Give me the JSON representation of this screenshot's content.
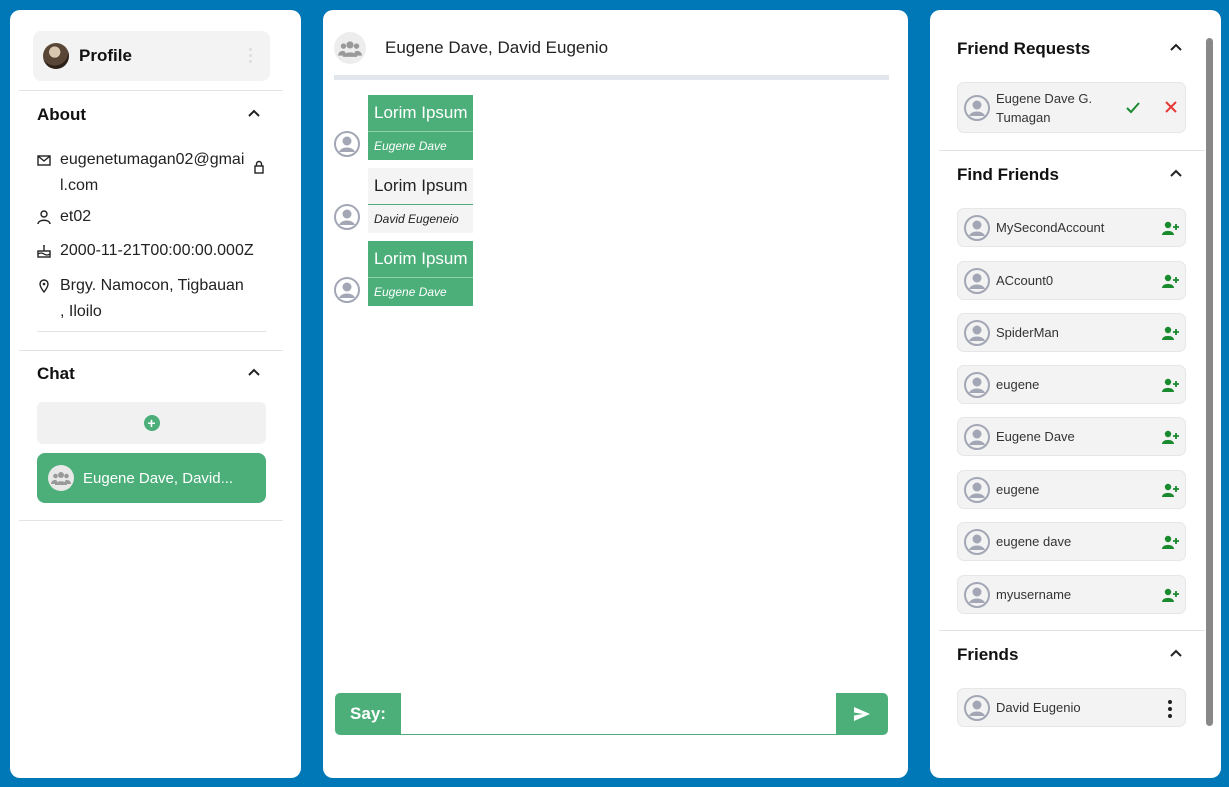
{
  "profile": {
    "name": "Profile"
  },
  "about": {
    "title": "About",
    "email": "eugenetumagan02@gmail.com",
    "username": "et02",
    "birthday": "2000-11-21T00:00:00.000Z",
    "address": "Brgy. Namocon, Tigbauan , Iloilo"
  },
  "chat_section": {
    "title": "Chat",
    "new_chat_symbol": "+",
    "items": [
      {
        "label": "Eugene Dave, David..."
      }
    ]
  },
  "conversation": {
    "title": "Eugene Dave, David Eugenio",
    "messages": [
      {
        "text": "Lorim Ipsum",
        "sender": "Eugene Dave"
      },
      {
        "text": "Lorim Ipsum",
        "sender": "David Eugeneio"
      },
      {
        "text": "Lorim Ipsum",
        "sender": "Eugene Dave"
      }
    ],
    "input": {
      "label": "Say:",
      "value": "",
      "placeholder": ""
    }
  },
  "friend_requests": {
    "title": "Friend Requests",
    "items": [
      {
        "name": "Eugene Dave G. Tumagan"
      }
    ]
  },
  "find_friends": {
    "title": "Find Friends",
    "items": [
      {
        "name": "MySecondAccount"
      },
      {
        "name": "ACcount0"
      },
      {
        "name": "SpiderMan"
      },
      {
        "name": "eugene"
      },
      {
        "name": "Eugene Dave"
      },
      {
        "name": "eugene"
      },
      {
        "name": "eugene dave"
      },
      {
        "name": "myusername"
      }
    ]
  },
  "friends": {
    "title": "Friends",
    "items": [
      {
        "name": "David Eugenio"
      }
    ]
  },
  "colors": {
    "background": "#0077b6",
    "accent": "#4caf7a",
    "add_friend_icon": "#1a8a2e",
    "reject_icon": "#e53935"
  },
  "icons": [
    "mail-icon",
    "lock-icon",
    "user-icon",
    "cake-icon",
    "location-icon",
    "chevron-up-icon",
    "group-icon",
    "send-icon",
    "person-add-icon",
    "check-icon",
    "close-icon",
    "more-vert-icon"
  ]
}
